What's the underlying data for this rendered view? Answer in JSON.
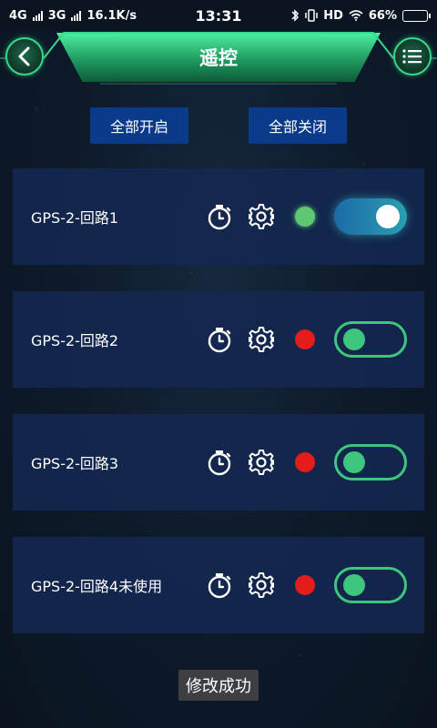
{
  "status_bar": {
    "network_1": "4G",
    "network_2": "3G",
    "speed": "16.1K/s",
    "time": "13:31",
    "hd": "HD",
    "battery": "66%",
    "battery_level": 0.66
  },
  "header": {
    "title": "遥控"
  },
  "actions": {
    "all_on": "全部开启",
    "all_off": "全部关闭"
  },
  "circuits": [
    {
      "label": "GPS-2-回路1",
      "status_color": "#5fc772",
      "on": true
    },
    {
      "label": "GPS-2-回路2",
      "status_color": "#e51c1c",
      "on": false
    },
    {
      "label": "GPS-2-回路3",
      "status_color": "#e51c1c",
      "on": false
    },
    {
      "label": "GPS-2-回路4未使用",
      "status_color": "#e51c1c",
      "on": false
    }
  ],
  "toast": "修改成功",
  "colors": {
    "accent_green": "#3ec67d",
    "button_blue": "#0b3a8a",
    "card_bg": "#142852"
  }
}
